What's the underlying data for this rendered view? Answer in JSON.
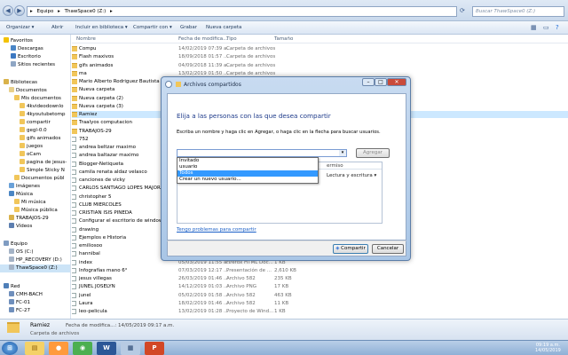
{
  "address": {
    "path": [
      "Equipo",
      "ThawSpace0 (Z:)"
    ],
    "search_placeholder": "Buscar ThawSpace0 (Z:)"
  },
  "toolbar": {
    "organize": "Organizar ▾",
    "open": "Abrir",
    "include": "Incluir en biblioteca ▾",
    "share": "Compartir con ▾",
    "burn": "Grabar",
    "new_folder": "Nueva carpeta"
  },
  "nav": {
    "favorites": "Favoritos",
    "downloads": "Descargas",
    "desktop": "Escritorio",
    "recent": "Sitios recientes",
    "libraries": "Bibliotecas",
    "documents": "Documentos",
    "mydocs": "Mis documentos",
    "sub": [
      "4kvideodownlo",
      "4kyoutubetomp",
      "compartir",
      "gegl-0.0",
      "gifs animados",
      "juegos",
      "oCam",
      "pagina de jesus-",
      "Simple Sticky N"
    ],
    "public_docs": "Documentos públ",
    "images": "Imágenes",
    "music": "Música",
    "my_music": "Mi música",
    "public_music": "Música pública",
    "trabajos": "TRABAJOS-29",
    "videos": "Vídeos",
    "computer": "Equipo",
    "os": "OS (C:)",
    "hp": "HP_RECOVERY (D:)",
    "thaw": "ThawSpace0 (Z:)",
    "network": "Red",
    "net": [
      "CMH-BACH",
      "FC-01",
      "FC-27"
    ]
  },
  "columns": {
    "name": "Nombre",
    "date": "Fecha de modifica...",
    "type": "Tipo",
    "size": "Tamaño"
  },
  "files": [
    {
      "name": "Compu",
      "date": "14/02/2019 07:39 a...",
      "type": "Carpeta de archivos",
      "size": "",
      "kind": "folder"
    },
    {
      "name": "Flash maxivos",
      "date": "18/09/2018 01:57 ...",
      "type": "Carpeta de archivos",
      "size": "",
      "kind": "folder"
    },
    {
      "name": "gifs animados",
      "date": "04/09/2018 11:39 a...",
      "type": "Carpeta de archivos",
      "size": "",
      "kind": "folder"
    },
    {
      "name": "ma",
      "date": "13/02/2019 01:50 ...",
      "type": "Carpeta de archivos",
      "size": "",
      "kind": "folder"
    },
    {
      "name": "Mario Alberto Rodriguez Bautista",
      "date": "",
      "type": "",
      "size": "",
      "kind": "folder"
    },
    {
      "name": "Nueva carpeta",
      "date": "",
      "type": "",
      "size": "",
      "kind": "folder"
    },
    {
      "name": "Nueva carpeta (2)",
      "date": "",
      "type": "",
      "size": "",
      "kind": "folder"
    },
    {
      "name": "Nueva carpeta (3)",
      "date": "",
      "type": "",
      "size": "",
      "kind": "folder"
    },
    {
      "name": "Ramiez",
      "date": "",
      "type": "",
      "size": "",
      "kind": "folder",
      "selected": true
    },
    {
      "name": "Traalyos computacion",
      "date": "",
      "type": "",
      "size": "",
      "kind": "folder"
    },
    {
      "name": "TRABAJOS-29",
      "date": "",
      "type": "",
      "size": "",
      "kind": "folder"
    },
    {
      "name": "752",
      "date": "",
      "type": "",
      "size": "",
      "kind": "file"
    },
    {
      "name": "andrea  beltzar  maximo",
      "date": "",
      "type": "",
      "size": "",
      "kind": "file"
    },
    {
      "name": "andrea  baltazar  maximo",
      "date": "",
      "type": "",
      "size": "",
      "kind": "file"
    },
    {
      "name": "Blogger-Netiqueta",
      "date": "",
      "type": "",
      "size": "",
      "kind": "file"
    },
    {
      "name": "camila renata aldaz velasco",
      "date": "",
      "type": "",
      "size": "",
      "kind": "file"
    },
    {
      "name": "canciones de vicky",
      "date": "",
      "type": "",
      "size": "",
      "kind": "file"
    },
    {
      "name": "CARLOS SANTIAGO LOPES MAJORA",
      "date": "",
      "type": "",
      "size": "",
      "kind": "file"
    },
    {
      "name": "christopher 5",
      "date": "",
      "type": "",
      "size": "",
      "kind": "file"
    },
    {
      "name": "CLUB MIERCOLES",
      "date": "",
      "type": "",
      "size": "",
      "kind": "file"
    },
    {
      "name": "CRISTIAN ISIS PINEDA",
      "date": "",
      "type": "",
      "size": "",
      "kind": "file"
    },
    {
      "name": "Configurar el escritorio de windows",
      "date": "",
      "type": "",
      "size": "",
      "kind": "file"
    },
    {
      "name": "drawing",
      "date": "",
      "type": "",
      "size": "",
      "kind": "file"
    },
    {
      "name": "Ejemplos e Historia",
      "date": "",
      "type": "",
      "size": "",
      "kind": "file"
    },
    {
      "name": "emiliosoo",
      "date": "",
      "type": "",
      "size": "",
      "kind": "file"
    },
    {
      "name": "hannibal",
      "date": "",
      "type": "",
      "size": "",
      "kind": "file"
    },
    {
      "name": "index",
      "date": "05/03/2019 11:55 a...",
      "type": "Firefox HTML Doc...",
      "size": "1 KB",
      "kind": "file"
    },
    {
      "name": "Infografías mano 6°",
      "date": "07/03/2019 12:17 ...",
      "type": "Presentación de ...",
      "size": "2,610 KB",
      "kind": "file"
    },
    {
      "name": "jesus villegas",
      "date": "26/03/2019 01:46 ...",
      "type": "Archivo 582",
      "size": "235 KB",
      "kind": "file"
    },
    {
      "name": "JUNEL JOSELYN",
      "date": "14/12/2019 01:03 ...",
      "type": "Archivo PNG",
      "size": "17 KB",
      "kind": "file"
    },
    {
      "name": "junel",
      "date": "05/02/2019 01:58 ...",
      "type": "Archivo 582",
      "size": "463 KB",
      "kind": "file"
    },
    {
      "name": "Laura",
      "date": "18/02/2019 01:46 ...",
      "type": "Archivo 582",
      "size": "11 KB",
      "kind": "file"
    },
    {
      "name": "leo-pelicula",
      "date": "13/02/2019 01:28 ...",
      "type": "Proyecto de Wind...",
      "size": "1 KB",
      "kind": "file"
    }
  ],
  "status": {
    "name": "Ramiez",
    "detail": "Fecha de modifica...: 14/05/2019 09:17 a.m.",
    "type": "Carpeta de archivos"
  },
  "dialog": {
    "title": "Archivos compartidos",
    "heading": "Elija a las personas con las que desea compartir",
    "instruction": "Escriba un nombre y haga clic en Agregar, o haga clic en la flecha para buscar usuarios.",
    "add_button": "Agregar",
    "options": [
      "Invitado",
      "usuario",
      "Todos",
      "Crear un nuevo usuario..."
    ],
    "selected_option": "Todos",
    "col_level": "ermiso",
    "perm_value": "Lectura y escritura ▾",
    "help_link": "Tengo problemas para compartir",
    "share_button": "Compartir",
    "cancel_button": "Cancelar"
  },
  "taskbar": {
    "time": "09:19 a.m.",
    "date": "14/05/2019"
  }
}
